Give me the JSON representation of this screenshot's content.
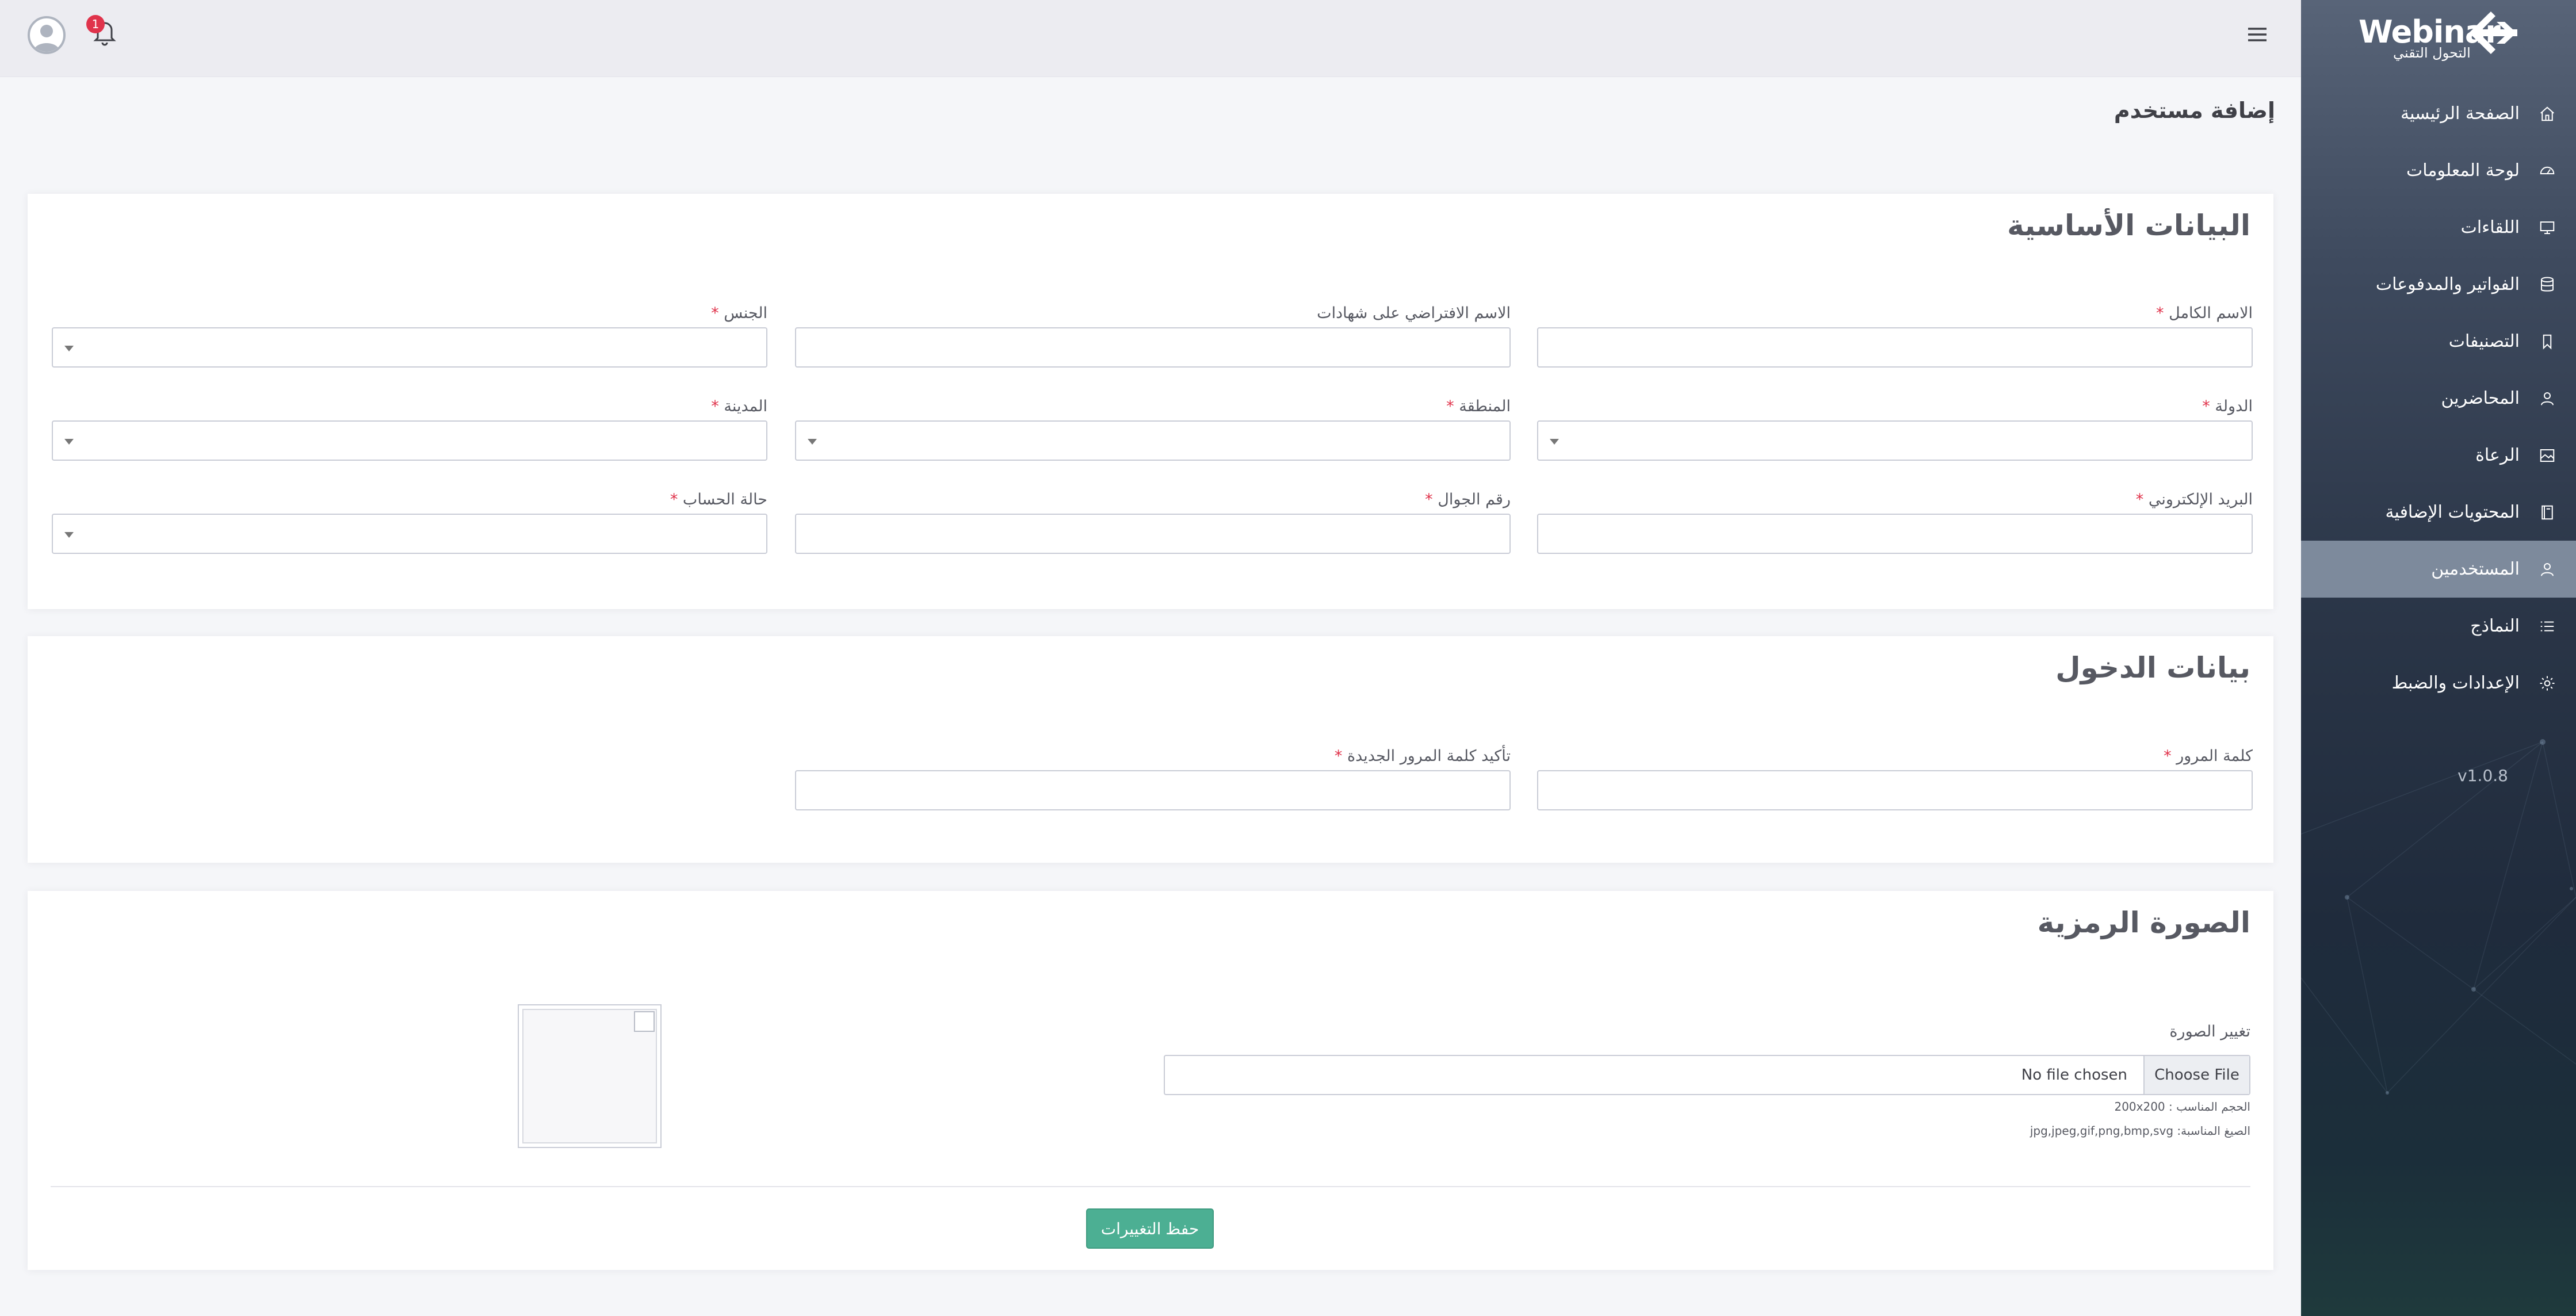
{
  "app": {
    "brand": "Webinar",
    "brand_sub": "التحول التقني",
    "version": "v1.0.8",
    "notification_count": "1",
    "accent_color": "#4caf93"
  },
  "sidebar": {
    "items": [
      {
        "label": "الصفحة الرئيسية",
        "icon": "home-icon"
      },
      {
        "label": "لوحة المعلومات",
        "icon": "dashboard-icon"
      },
      {
        "label": "اللقاءات",
        "icon": "monitor-icon"
      },
      {
        "label": "الفواتير والمدفوعات",
        "icon": "database-icon"
      },
      {
        "label": "التصنيفات",
        "icon": "bookmark-icon"
      },
      {
        "label": "المحاضرين",
        "icon": "user-icon"
      },
      {
        "label": "الرعاة",
        "icon": "image-icon"
      },
      {
        "label": "المحتويات الإضافية",
        "icon": "book-icon"
      },
      {
        "label": "المستخدمين",
        "icon": "user-icon",
        "active": true
      },
      {
        "label": "النماذج",
        "icon": "list-icon"
      },
      {
        "label": "الإعدادات والضبط",
        "icon": "gear-icon"
      }
    ]
  },
  "page": {
    "title": "إضافة مستخدم"
  },
  "basic": {
    "heading": "البيانات الأساسية",
    "full_name": "الاسم الكامل",
    "default_name": "الاسم الافتراضي على شهادات",
    "gender": "الجنس",
    "country": "الدولة",
    "region": "المنطقة",
    "city": "المدينة",
    "email": "البريد الإلكتروني",
    "mobile": "رقم الجوال",
    "status": "حالة الحساب",
    "required_mark": "*"
  },
  "login": {
    "heading": "بيانات الدخول",
    "password": "كلمة المرور",
    "confirm": "تأكيد كلمة المرور الجديدة"
  },
  "avatar": {
    "heading": "الصورة الرمزية",
    "change_label": "تغيير الصورة",
    "choose_file": "Choose File",
    "no_file": "No file chosen",
    "size_hint": "الحجم المناسب : 200x200",
    "format_hint": "الصيغ المناسبة: jpg,jpeg,gif,png,bmp,svg"
  },
  "actions": {
    "save": "حفظ التغييرات"
  }
}
